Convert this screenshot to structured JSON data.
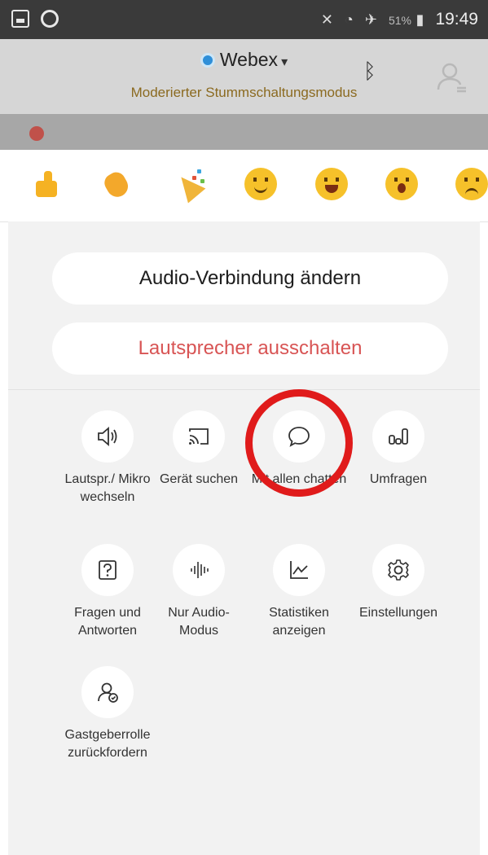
{
  "status_bar": {
    "left_icons": [
      "gallery-icon",
      "sync-icon"
    ],
    "right_icons": [
      "mute-icon",
      "wifi-icon",
      "airplane-icon",
      "battery-icon"
    ],
    "battery_percent": "51%",
    "time": "19:49"
  },
  "header": {
    "app_name": "Webex",
    "subtitle": "Moderierter Stummschaltungsmodus",
    "icons": [
      "bluetooth-icon",
      "participant-icon"
    ]
  },
  "reactions": [
    "thumbs-up",
    "clapping",
    "celebration",
    "smile",
    "laughing",
    "surprised",
    "sad"
  ],
  "buttons": {
    "change_audio": "Audio-Verbindung ändern",
    "mute_speaker": "Lautsprecher ausschalten"
  },
  "actions": [
    {
      "label": "Lautspr./ Mikro wechseln",
      "icon": "speaker-icon"
    },
    {
      "label": "Gerät suchen",
      "icon": "cast-icon"
    },
    {
      "label": "Mit allen chatten",
      "icon": "chat-icon"
    },
    {
      "label": "Umfragen",
      "icon": "poll-icon"
    },
    {
      "label": "Fragen und Antworten",
      "icon": "qa-icon"
    },
    {
      "label": "Nur Audio-Modus",
      "icon": "audio-wave-icon"
    },
    {
      "label": "Statistiken anzeigen",
      "icon": "statistics-icon"
    },
    {
      "label": "Einstellungen",
      "icon": "gear-icon"
    },
    {
      "label": "Gastgeberrolle zurückfordern",
      "icon": "reclaim-host-icon"
    }
  ],
  "colors": {
    "highlight": "#e01b1b",
    "danger_text": "#d85454",
    "subtitle_text": "#8b6a20",
    "webex_blue": "#2f8fd8"
  }
}
